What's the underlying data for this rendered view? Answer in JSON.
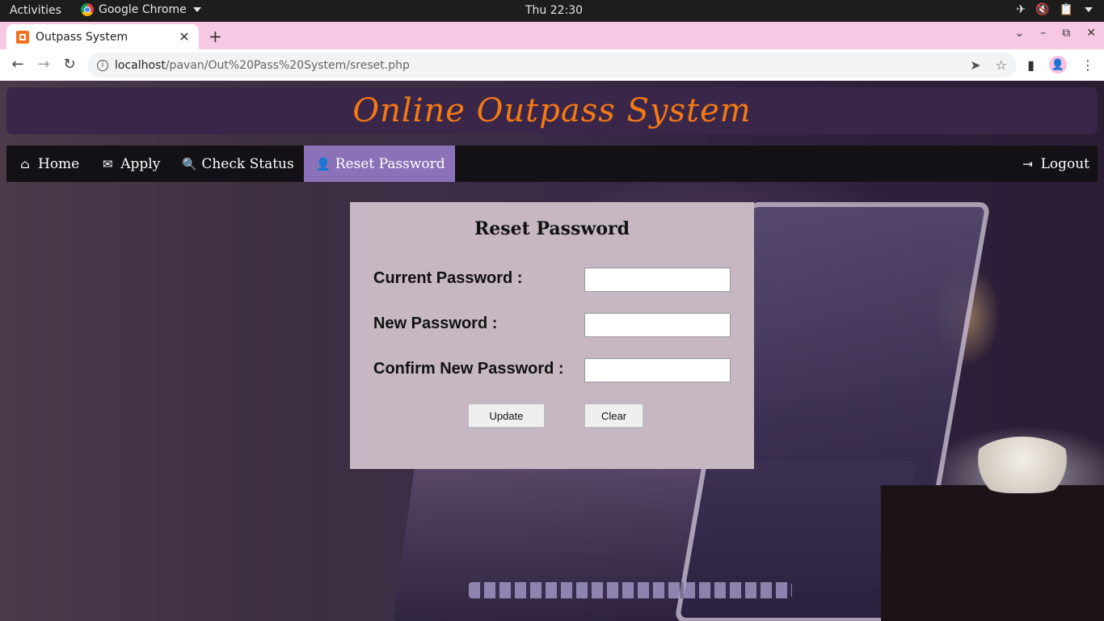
{
  "os": {
    "activities": "Activities",
    "app_name": "Google Chrome",
    "clock": "Thu 22:30",
    "tray_icons": [
      "airplane-icon",
      "volume-muted-icon",
      "clipboard-icon",
      "power-menu-icon"
    ]
  },
  "browser": {
    "tab_title": "Outpass System",
    "url_host": "localhost",
    "url_path": "/pavan/Out%20Pass%20System/sreset.php"
  },
  "page": {
    "site_title": "Online Outpass System",
    "nav": {
      "home": "Home",
      "apply": "Apply",
      "check_status": "Check Status",
      "reset_password": "Reset Password",
      "logout": "Logout"
    },
    "form": {
      "title": "Reset Password",
      "current_password_label": "Current Password :",
      "new_password_label": "New Password :",
      "confirm_password_label": "Confirm New Password :",
      "current_password_value": "",
      "new_password_value": "",
      "confirm_password_value": "",
      "update_button": "Update",
      "clear_button": "Clear"
    },
    "colors": {
      "title_orange": "#f47a14",
      "nav_active": "#8b72b8",
      "panel_bg": "#c6b7c3"
    }
  }
}
